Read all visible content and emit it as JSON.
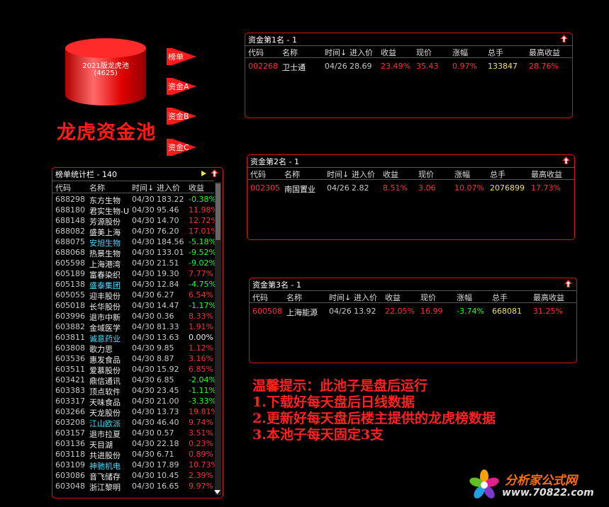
{
  "pool": {
    "cylinder_line1": "2021版龙虎池",
    "cylinder_line2": "(4625)",
    "buttons": [
      "榜单",
      "资金A",
      "资金B",
      "资金C"
    ],
    "title": "龙虎资金池"
  },
  "columns_top": [
    "代码",
    "名称",
    "时间↓",
    "进入价",
    "收益",
    "现价",
    "涨幅",
    "总手",
    "最高收益"
  ],
  "panels": [
    {
      "title": "资金第1名 - 1",
      "row": [
        "002268",
        "卫士通",
        "04/26",
        "28.69",
        "23.49%",
        "35.43",
        "0.97%",
        "133847",
        "28.76%"
      ]
    },
    {
      "title": "资金第2名 - 1",
      "row": [
        "002305",
        "南国置业",
        "04/26",
        "2.82",
        "8.51%",
        "3.06",
        "10.07%",
        "2076899",
        "17.73%"
      ]
    },
    {
      "title": "资金第3名 - 1",
      "row": [
        "600508",
        "上海能源",
        "04/26",
        "13.92",
        "22.05%",
        "16.99",
        "-3.74%",
        "668081",
        "31.25%"
      ]
    }
  ],
  "list": {
    "title": "榜单统计栏 - 140",
    "columns": [
      "代码",
      "名称",
      "时间↓",
      "进入价",
      "收益"
    ],
    "rows": [
      [
        "688298",
        "东方生物",
        "04/30",
        "183.22",
        "-0.38%"
      ],
      [
        "688180",
        "君实生物-U",
        "04/30",
        "95.46",
        "11.98%"
      ],
      [
        "688148",
        "芳源股份",
        "04/30",
        "14.70",
        "12.72%"
      ],
      [
        "688082",
        "盛美上海",
        "04/30",
        "76.20",
        "17.01%"
      ],
      [
        "688075",
        "安旭生物",
        "04/30",
        "184.56",
        "-5.18%"
      ],
      [
        "688068",
        "热景生物",
        "04/30",
        "133.01",
        "-9.52%"
      ],
      [
        "605598",
        "上海港湾",
        "04/30",
        "21.51",
        "-9.02%"
      ],
      [
        "605189",
        "富春染织",
        "04/30",
        "19.30",
        "7.77%"
      ],
      [
        "605138",
        "盛泰集团",
        "04/30",
        "12.84",
        "-4.75%"
      ],
      [
        "605055",
        "迎丰股份",
        "04/30",
        "6.27",
        "6.54%"
      ],
      [
        "605018",
        "长华股份",
        "04/30",
        "14.47",
        "-1.17%"
      ],
      [
        "603996",
        "退市中新",
        "04/30",
        "0.36",
        "8.33%"
      ],
      [
        "603882",
        "金域医学",
        "04/30",
        "81.33",
        "1.91%"
      ],
      [
        "603811",
        "诚意药业",
        "04/30",
        "13.63",
        "0.00%"
      ],
      [
        "603808",
        "歌力思",
        "04/30",
        "9.85",
        "1.12%"
      ],
      [
        "603536",
        "惠发食品",
        "04/30",
        "8.87",
        "3.16%"
      ],
      [
        "603511",
        "爱慕股份",
        "04/30",
        "15.92",
        "6.85%"
      ],
      [
        "603421",
        "鼎信通讯",
        "04/30",
        "6.85",
        "-2.04%"
      ],
      [
        "603383",
        "顶点软件",
        "04/30",
        "23.45",
        "-1.11%"
      ],
      [
        "603317",
        "天味食品",
        "04/30",
        "21.00",
        "-3.33%"
      ],
      [
        "603266",
        "天龙股份",
        "04/30",
        "13.73",
        "19.81%"
      ],
      [
        "603208",
        "江山欧派",
        "04/30",
        "46.40",
        "9.74%"
      ],
      [
        "603157",
        "退市拉夏",
        "04/30",
        "0.57",
        "3.51%"
      ],
      [
        "603136",
        "天目湖",
        "04/30",
        "22.18",
        "0.23%"
      ],
      [
        "603118",
        "共进股份",
        "04/30",
        "6.71",
        "0.89%"
      ],
      [
        "603109",
        "神驰机电",
        "04/30",
        "17.89",
        "10.73%"
      ],
      [
        "603086",
        "音飞储存",
        "04/30",
        "10.45",
        "2.39%"
      ],
      [
        "603048",
        "浙江黎明",
        "04/30",
        "16.65",
        "9.97%"
      ]
    ]
  },
  "notes": [
    "温馨提示：此池子是盘后运行",
    "1.下载好每天盘后日线数据",
    "2.更新好每天盘后楼主提供的龙虎榜数据",
    "3.本池子每天固定3支"
  ],
  "logo": {
    "name": "分析家公式网",
    "url": "www.70822.com"
  },
  "colors": {
    "border": "#e01010",
    "gain": "#ff3030",
    "loss": "#20ff20",
    "volume": "#f0e060",
    "highlight": "#40e0ff"
  }
}
